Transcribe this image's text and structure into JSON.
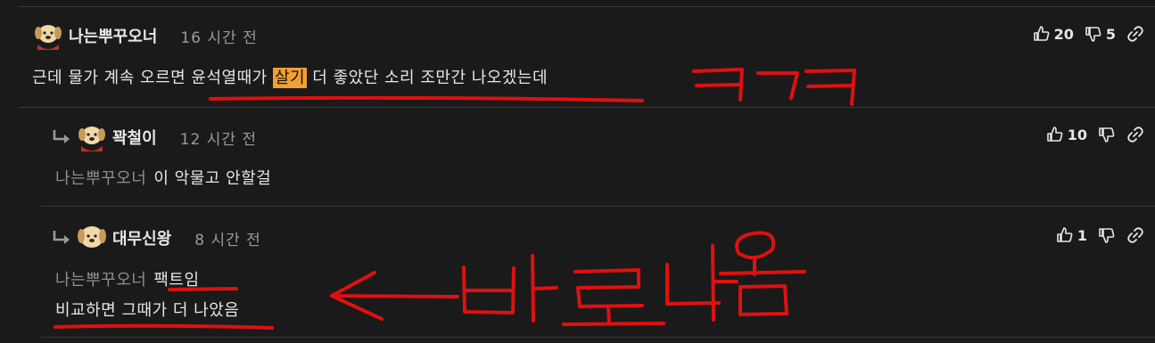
{
  "comments": [
    {
      "author": "나는뿌꾸오너",
      "time": "16 시간 전",
      "text_before": "근데 물가 계속 오르면 윤석열때가 ",
      "text_highlight": "살기",
      "text_after": " 더 좋았단 소리 조만간 나오겠는데",
      "likes": "20",
      "dislikes": "5"
    },
    {
      "author": "꽉철이",
      "time": "12 시간 전",
      "mention": "나는뿌꾸오너",
      "text": "이 악물고 안할걸",
      "likes": "10"
    },
    {
      "author": "대무신왕",
      "time": "8 시간 전",
      "mention": "나는뿌꾸오너",
      "line1": "팩트임",
      "line2": "비교하면 그때가 더 나았음",
      "likes": "1"
    }
  ],
  "icons": {
    "like": "thumbs-up-icon",
    "dislike": "thumbs-down-icon",
    "link": "link-icon",
    "reply": "reply-arrow-icon",
    "avatar": "puppy-avatar-icon"
  },
  "annotations": {
    "laugh": "ㅋㅋㅋ",
    "pointer": "← 바로 나옴",
    "color": "#e01010"
  },
  "colors": {
    "background": "#1a1a1a",
    "highlight": "#f0a030",
    "muted": "#8e8e8e"
  }
}
